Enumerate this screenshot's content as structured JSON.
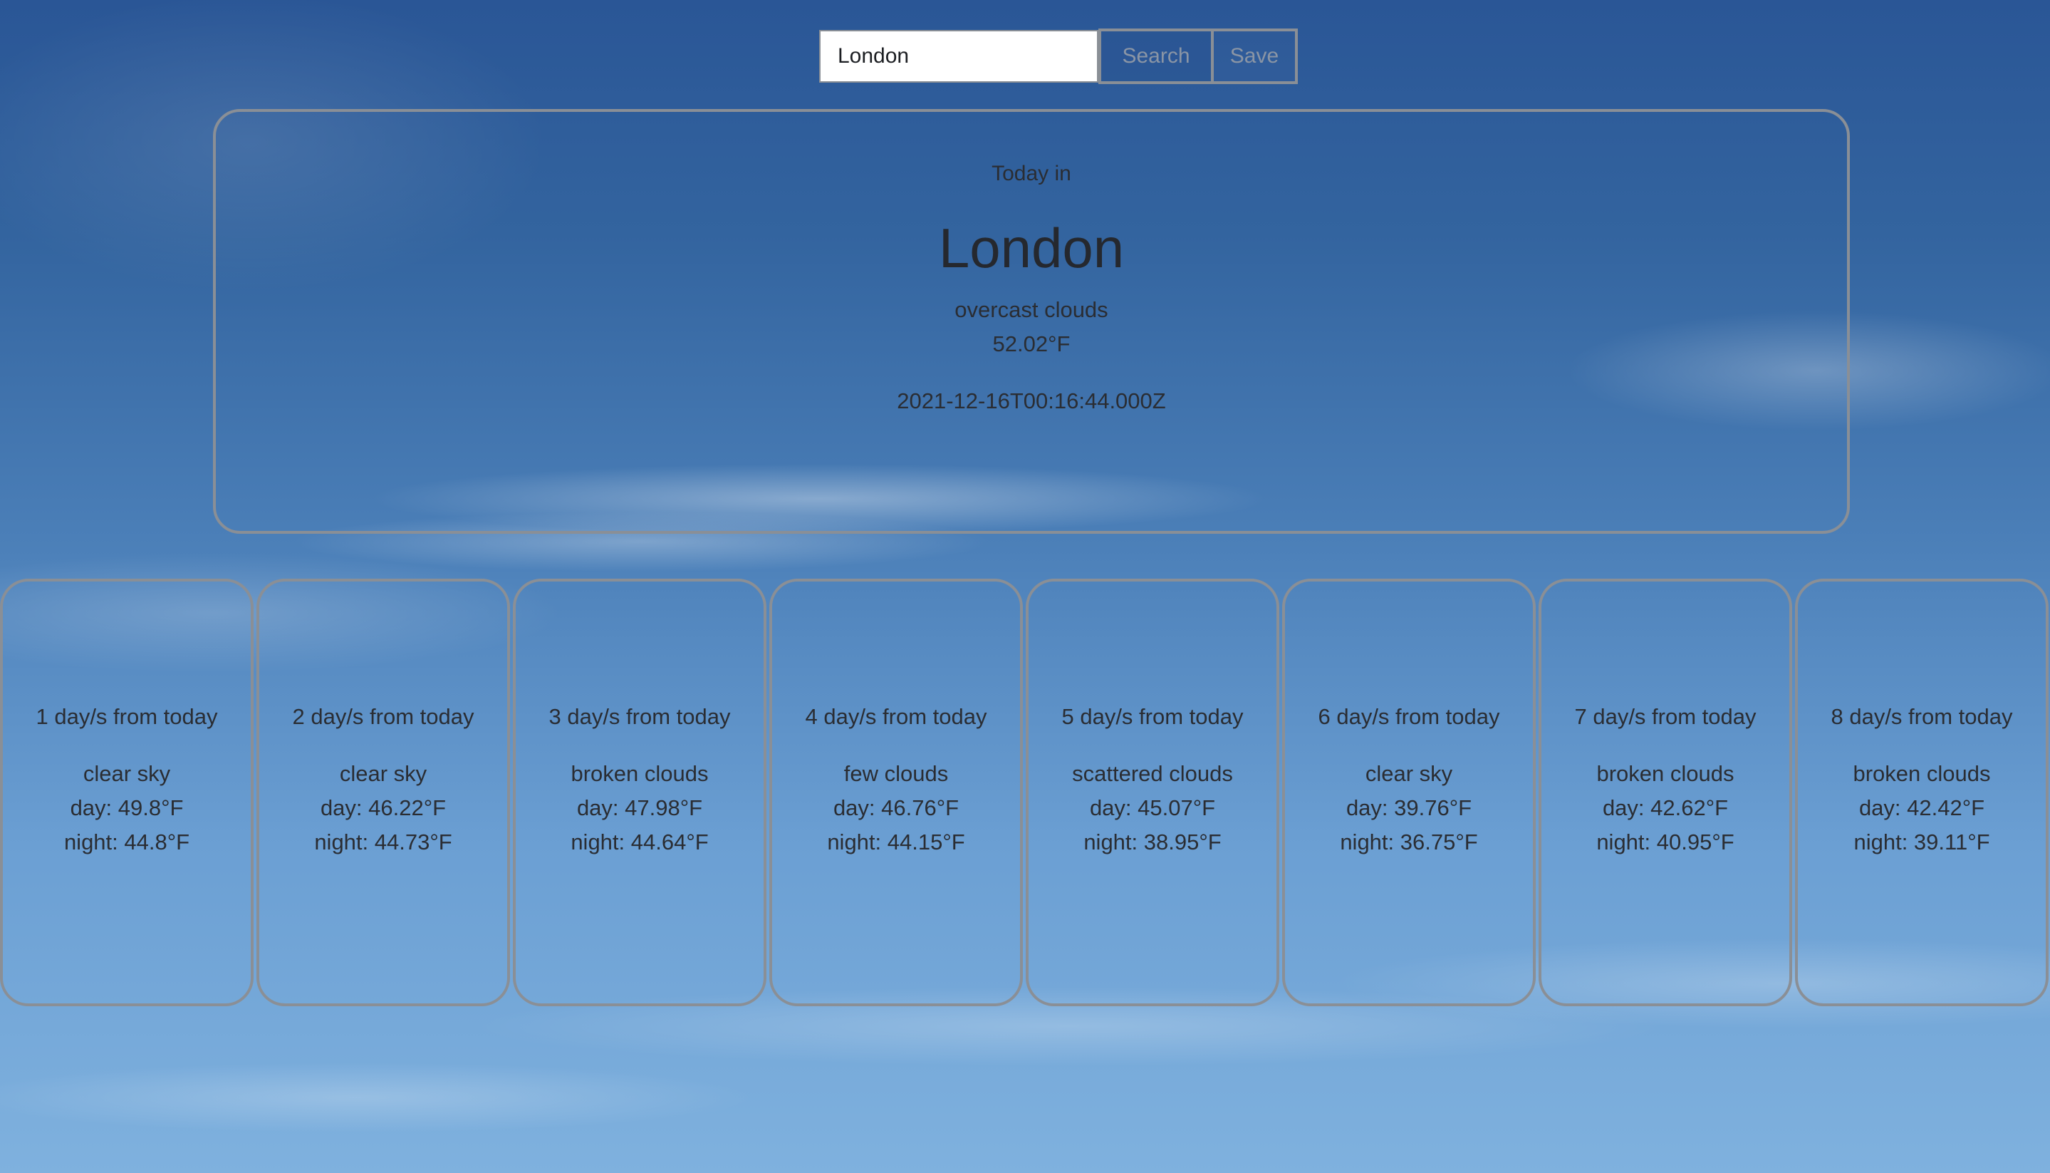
{
  "search": {
    "value": "London",
    "search_label": "Search",
    "save_label": "Save"
  },
  "today": {
    "label": "Today in",
    "city": "London",
    "description": "overcast clouds",
    "temperature": "52.02°F",
    "timestamp": "2021-12-16T00:16:44.000Z"
  },
  "forecast": [
    {
      "title": "1 day/s from today",
      "description": "clear sky",
      "day": "day: 49.8°F",
      "night": "night: 44.8°F"
    },
    {
      "title": "2 day/s from today",
      "description": "clear sky",
      "day": "day: 46.22°F",
      "night": "night: 44.73°F"
    },
    {
      "title": "3 day/s from today",
      "description": "broken clouds",
      "day": "day: 47.98°F",
      "night": "night: 44.64°F"
    },
    {
      "title": "4 day/s from today",
      "description": "few clouds",
      "day": "day: 46.76°F",
      "night": "night: 44.15°F"
    },
    {
      "title": "5 day/s from today",
      "description": "scattered clouds",
      "day": "day: 45.07°F",
      "night": "night: 38.95°F"
    },
    {
      "title": "6 day/s from today",
      "description": "clear sky",
      "day": "day: 39.76°F",
      "night": "night: 36.75°F"
    },
    {
      "title": "7 day/s from today",
      "description": "broken clouds",
      "day": "day: 42.62°F",
      "night": "night: 40.95°F"
    },
    {
      "title": "8 day/s from today",
      "description": "broken clouds",
      "day": "day: 42.42°F",
      "night": "night: 39.11°F"
    }
  ]
}
